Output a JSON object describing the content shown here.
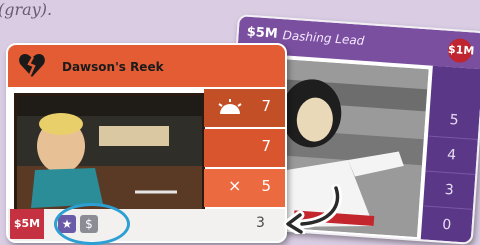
{
  "caption": "(gray).",
  "back_card": {
    "cost": "$5M",
    "title": "Dashing Lead",
    "badge": "$1M",
    "stats": [
      "5",
      "4",
      "3",
      "0"
    ]
  },
  "front_card": {
    "title": "Dawson's Reek",
    "heart_icon": "broken-heart-icon",
    "stats": {
      "sun": "7",
      "plain": "7",
      "multiply_symbol": "×",
      "multiply": "5"
    },
    "footer": {
      "cost": "$5M",
      "icons": [
        "star-icon",
        "dollar-icon"
      ],
      "value": "3"
    },
    "colors": {
      "header": "#e35c34",
      "accent": "#c63142",
      "highlight": "#2c9fd3"
    }
  }
}
